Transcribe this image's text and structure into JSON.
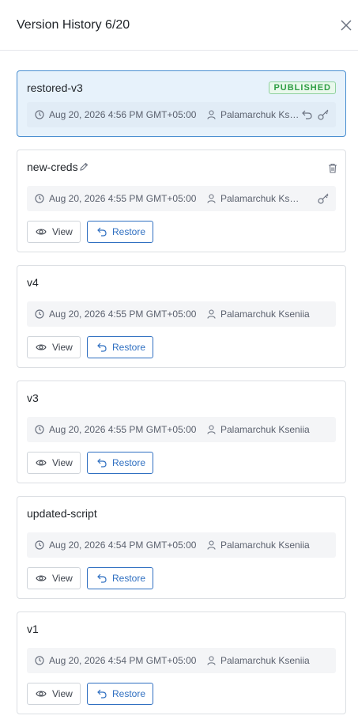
{
  "panel": {
    "title": "Version History 6/20"
  },
  "versions": [
    {
      "name": "restored-v3",
      "badge": "PUBLISHED",
      "date": "Aug 20, 2026 4:56 PM GMT+05:00",
      "author": "Palamarchuk Kseniia"
    },
    {
      "name": "new-creds",
      "date": "Aug 20, 2026 4:55 PM GMT+05:00",
      "author": "Palamarchuk Kseniia",
      "view_label": "View",
      "restore_label": "Restore"
    },
    {
      "name": "v4",
      "date": "Aug 20, 2026 4:55 PM GMT+05:00",
      "author": "Palamarchuk Kseniia",
      "view_label": "View",
      "restore_label": "Restore"
    },
    {
      "name": "v3",
      "date": "Aug 20, 2026 4:55 PM GMT+05:00",
      "author": "Palamarchuk Kseniia",
      "view_label": "View",
      "restore_label": "Restore"
    },
    {
      "name": "updated-script",
      "date": "Aug 20, 2026 4:54 PM GMT+05:00",
      "author": "Palamarchuk Kseniia",
      "view_label": "View",
      "restore_label": "Restore"
    },
    {
      "name": "v1",
      "date": "Aug 20, 2026 4:54 PM GMT+05:00",
      "author": "Palamarchuk Kseniia",
      "view_label": "View",
      "restore_label": "Restore"
    }
  ],
  "icons": {
    "close": "close-icon",
    "clock": "clock-icon",
    "user": "user-icon",
    "undo": "undo-icon",
    "key": "key-icon",
    "pencil": "pencil-icon",
    "trash": "trash-icon",
    "eye": "eye-icon",
    "restore": "restore-icon"
  },
  "colors": {
    "accent": "#2f6fc1",
    "active_bg": "#e7f2fb",
    "published": "#2f9e44"
  }
}
